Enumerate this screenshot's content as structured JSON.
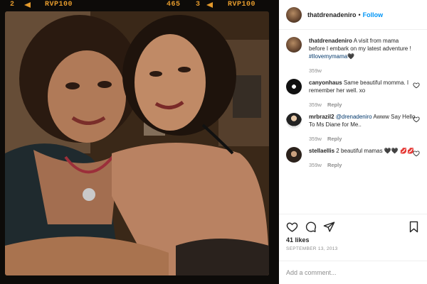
{
  "film_strip": {
    "frame_left": "2",
    "brand_left": "RVP100",
    "frame_mid": "465",
    "frame_right": "3",
    "brand_right": "RVP100",
    "color": "#e49a2c"
  },
  "post": {
    "image_alt": "Photo of two women hugging",
    "username": "thatdrenadeniro",
    "follow_label": "Follow",
    "caption_text": "A visit from mama before I embark on my latest adventure ! ",
    "caption_hashtag": "#Ilovemymama",
    "caption_emoji": "🖤",
    "caption_time": "359w",
    "likes": "41 likes",
    "date": "SEPTEMBER 13, 2013",
    "add_comment_placeholder": "Add a comment..."
  },
  "comments": [
    {
      "username": "canyonhaus",
      "text": "Same beautiful momma. I remember her well. xo",
      "time": "359w",
      "reply_label": "Reply",
      "avatar": "canyon"
    },
    {
      "username": "mrbrazil2",
      "mention": "@drenadeniro",
      "text": "Awww Say Hello To Ms Diane for Me..",
      "time": "359w",
      "reply_label": "Reply",
      "avatar": "mr"
    },
    {
      "username": "stellaellis",
      "text": "2 beautiful mamas 🖤🖤 💋💋",
      "time": "359w",
      "reply_label": "Reply",
      "avatar": "stella"
    }
  ],
  "icons": {
    "heart": "heart-icon",
    "comment": "comment-icon",
    "share": "share-icon",
    "bookmark": "bookmark-icon"
  },
  "colors": {
    "link": "#0095f6",
    "hashtag": "#00376b",
    "muted": "#8e8e8e"
  }
}
